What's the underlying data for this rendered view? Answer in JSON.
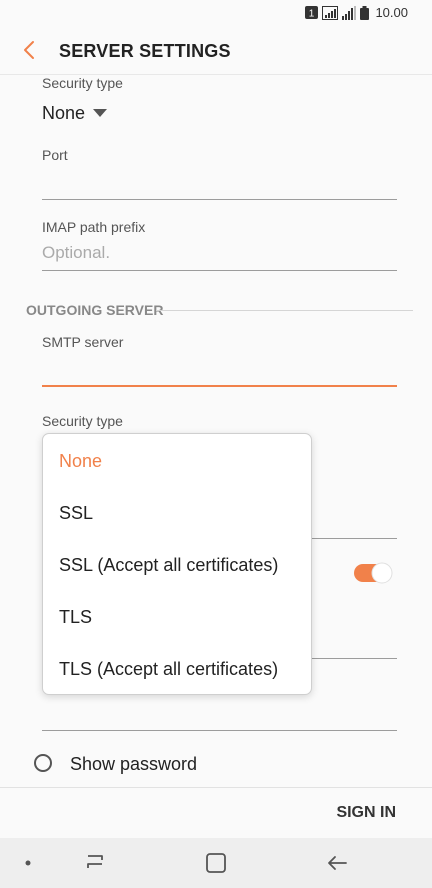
{
  "status": {
    "time": "10.00",
    "notification_badge": "1"
  },
  "header": {
    "title": "SERVER SETTINGS"
  },
  "incoming": {
    "security_type_label": "Security type",
    "security_type_value": "None",
    "port_label": "Port",
    "port_value": "",
    "imap_label": "IMAP path prefix",
    "imap_placeholder": "Optional."
  },
  "outgoing": {
    "section_title": "OUTGOING SERVER",
    "smtp_label": "SMTP server",
    "smtp_value": "",
    "security_type_label": "Security type"
  },
  "dropdown": {
    "options": [
      "None",
      "SSL",
      "SSL (Accept all certificates)",
      "TLS",
      "TLS (Accept all certificates)"
    ],
    "selected_index": 0
  },
  "toggle": {
    "on": true
  },
  "show_password_label": "Show password",
  "footer": {
    "sign_in_label": "SIGN IN"
  },
  "colors": {
    "accent": "#f1814a"
  }
}
